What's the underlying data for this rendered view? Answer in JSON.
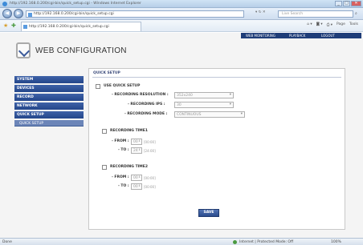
{
  "browser": {
    "window_title": "http://192.168.0.200/cgi-bin/quick_setup.cgi - Windows Internet Explorer",
    "address": "http://192.168.0.200/cgi-bin/quick_setup.cgi",
    "search_placeholder": "Live Search",
    "tab_title": "http://192.168.0.200/cgi-bin/quick_setup.cgi",
    "commands": [
      "Page",
      "Tools"
    ],
    "status_left": "Done",
    "zone": "Internet | Protected Mode: Off",
    "zoom": "100%"
  },
  "header": {
    "logo_text": "WEB CONFIGURATION",
    "top_links": [
      "WEB MONITORING",
      "PLAYBACK",
      "LOGOUT"
    ]
  },
  "sidebar": {
    "items": [
      {
        "label": "SYSTEM"
      },
      {
        "label": "DEVICES"
      },
      {
        "label": "RECORD"
      },
      {
        "label": "NETWORK"
      },
      {
        "label": "QUICK SETUP"
      }
    ],
    "sub_items": [
      {
        "label": "QUICK SETUP"
      }
    ]
  },
  "main": {
    "title": "QUICK SETUP",
    "use_quick_setup": "USE QUICK SETUP",
    "resolution_label": "- RECORDING RESOLUTION :",
    "resolution_value": "352x240",
    "ips_label": "- RECORDING IPS :",
    "ips_value": "30",
    "mode_label": "- RECORDING MODE :",
    "mode_value": "CONTINUOUS",
    "time1_label": "RECORDING TIME1",
    "time2_label": "RECORDING TIME2",
    "from_label": "- FROM :",
    "to_label": "- TO :",
    "time1_from": "00",
    "time1_to": "24",
    "time2_from": "00",
    "time2_to": "00",
    "unit_hour": "[00:00]",
    "unit_hour_to": "[24:00]",
    "save_label": "SAVE"
  }
}
